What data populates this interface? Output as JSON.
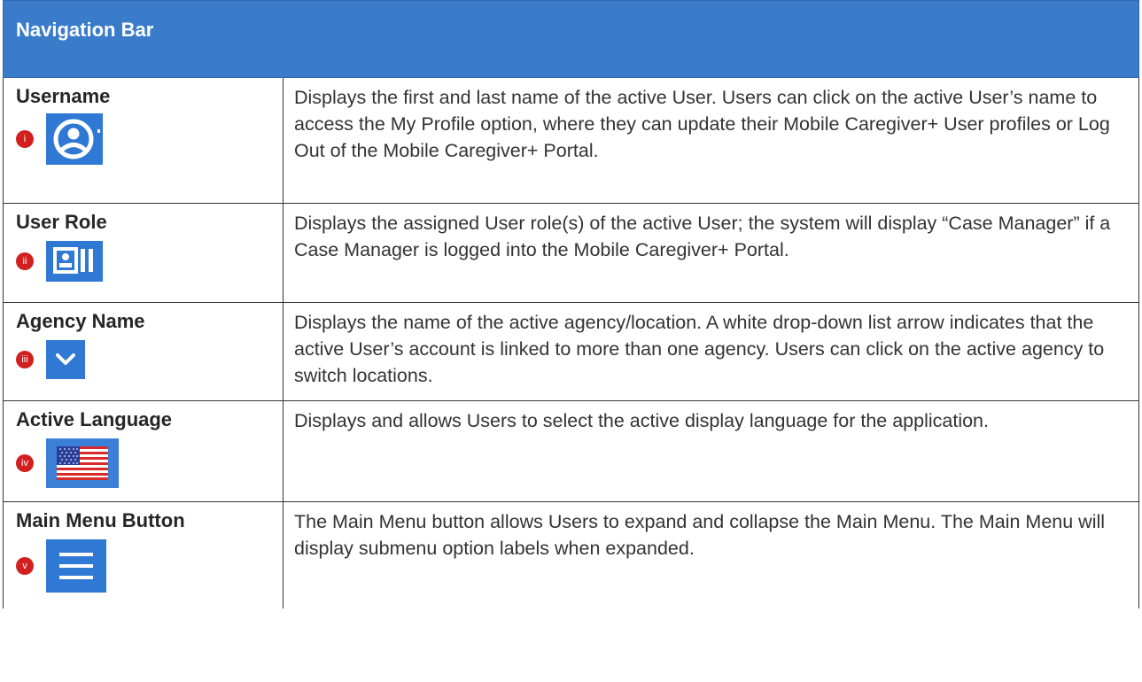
{
  "header": {
    "title": "Navigation Bar"
  },
  "rows": [
    {
      "label": "Username",
      "badge": "i",
      "icon": "user-circle-icon",
      "description": "Displays the first and last name of the active User. Users can click on the active User’s name to access the My Profile option, where they can update their Mobile Caregiver+ User profiles or Log Out of the Mobile Caregiver+ Portal."
    },
    {
      "label": "User Role",
      "badge": "ii",
      "icon": "id-card-icon",
      "description": "Displays the assigned User role(s) of the active User; the system will display “Case Manager” if a Case Manager is logged into the Mobile Caregiver+ Portal."
    },
    {
      "label": "Agency Name",
      "badge": "iii",
      "icon": "chevron-down-icon",
      "description": "Displays the name of the active agency/location. A white drop-down list arrow indicates that the active User’s account is linked to more than one agency. Users can click on the active agency to switch locations."
    },
    {
      "label": "Active Language",
      "badge": "iv",
      "icon": "us-flag-icon",
      "description": "Displays and allows Users to select the active display language for the application."
    },
    {
      "label": "Main Menu Button",
      "badge": "v",
      "icon": "hamburger-menu-icon",
      "description": "The Main Menu button allows Users to expand and collapse the Main Menu. The Main Menu will display submenu option labels when expanded."
    }
  ],
  "colors": {
    "header_bg": "#3a7bca",
    "icon_bg": "#2f78d4",
    "badge": "#d21f1f"
  }
}
